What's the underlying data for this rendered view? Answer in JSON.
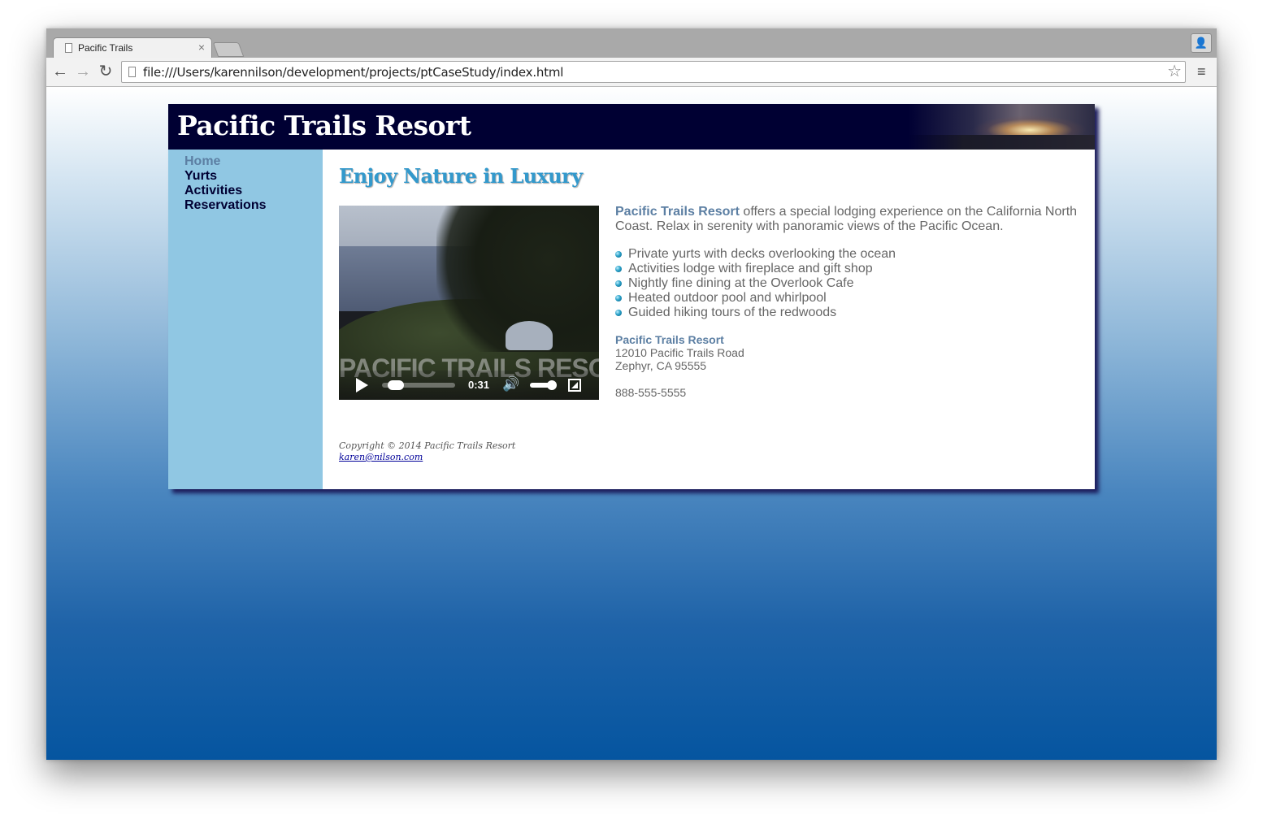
{
  "browser": {
    "tab_title": "Pacific Trails",
    "tab_close": "×",
    "url": "file:///Users/karennilson/development/projects/ptCaseStudy/index.html",
    "back": "←",
    "forward": "→",
    "reload": "↻",
    "star": "☆",
    "menu": "≡",
    "profile": "👤",
    "icons": [
      "page-icon",
      "back-arrow-icon",
      "forward-arrow-icon",
      "reload-icon",
      "star-icon",
      "menu-icon",
      "profile-icon"
    ]
  },
  "site": {
    "title": "Pacific Trails Resort",
    "nav": [
      {
        "label": "Home",
        "current": true
      },
      {
        "label": "Yurts",
        "current": false
      },
      {
        "label": "Activities",
        "current": false
      },
      {
        "label": "Reservations",
        "current": false
      }
    ],
    "heading": "Enjoy Nature in Luxury",
    "video": {
      "overlay_text": "PACIFIC TRAILS RESORT",
      "time": "0:31",
      "progress_fraction": 0.08,
      "volume_fraction": 0.9
    },
    "intro_brand": "Pacific Trails Resort",
    "intro_text": " offers a special lodging experience on the California North Coast. Relax in serenity with panoramic views of the Pacific Ocean.",
    "features": [
      "Private yurts with decks overlooking the ocean",
      "Activities lodge with fireplace and gift shop",
      "Nightly fine dining at the Overlook Cafe",
      "Heated outdoor pool and whirlpool",
      "Guided hiking tours of the redwoods"
    ],
    "address": {
      "name": "Pacific Trails Resort",
      "street": "12010 Pacific Trails Road",
      "city": "Zephyr, CA 95555",
      "phone": "888-555-5555"
    },
    "footer": {
      "copyright": "Copyright © 2014 Pacific Trails Resort",
      "email": "karen@nilson.com"
    }
  },
  "colors": {
    "header_bg": "#000033",
    "nav_bg": "#90c7e3",
    "heading": "#3399cc",
    "brand": "#5c7fa3",
    "body_text": "#666666"
  }
}
